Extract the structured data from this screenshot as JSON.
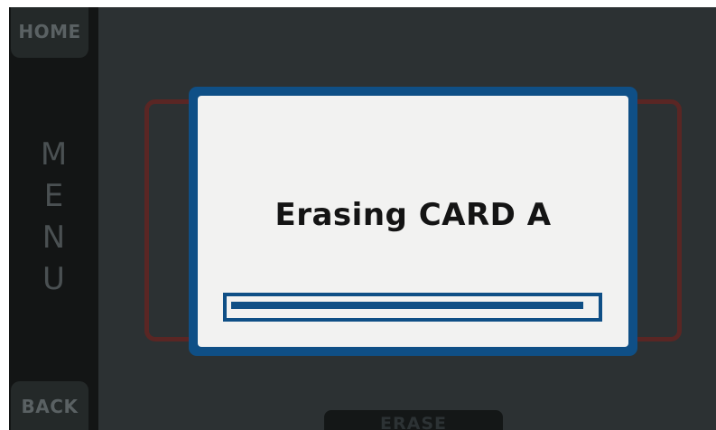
{
  "sidebar": {
    "home_label": "HOME",
    "menu_letters": [
      "M",
      "E",
      "N",
      "U"
    ],
    "back_label": "BACK"
  },
  "bottom": {
    "erase_label": "ERASE"
  },
  "dialog": {
    "title": "Erasing CARD A",
    "progress": 0.97
  },
  "colors": {
    "screen_background": "#2c3133",
    "dialog_border": "#0f4f86",
    "dialog_background": "#f2f2f1",
    "card_outline": "#5a2624"
  }
}
